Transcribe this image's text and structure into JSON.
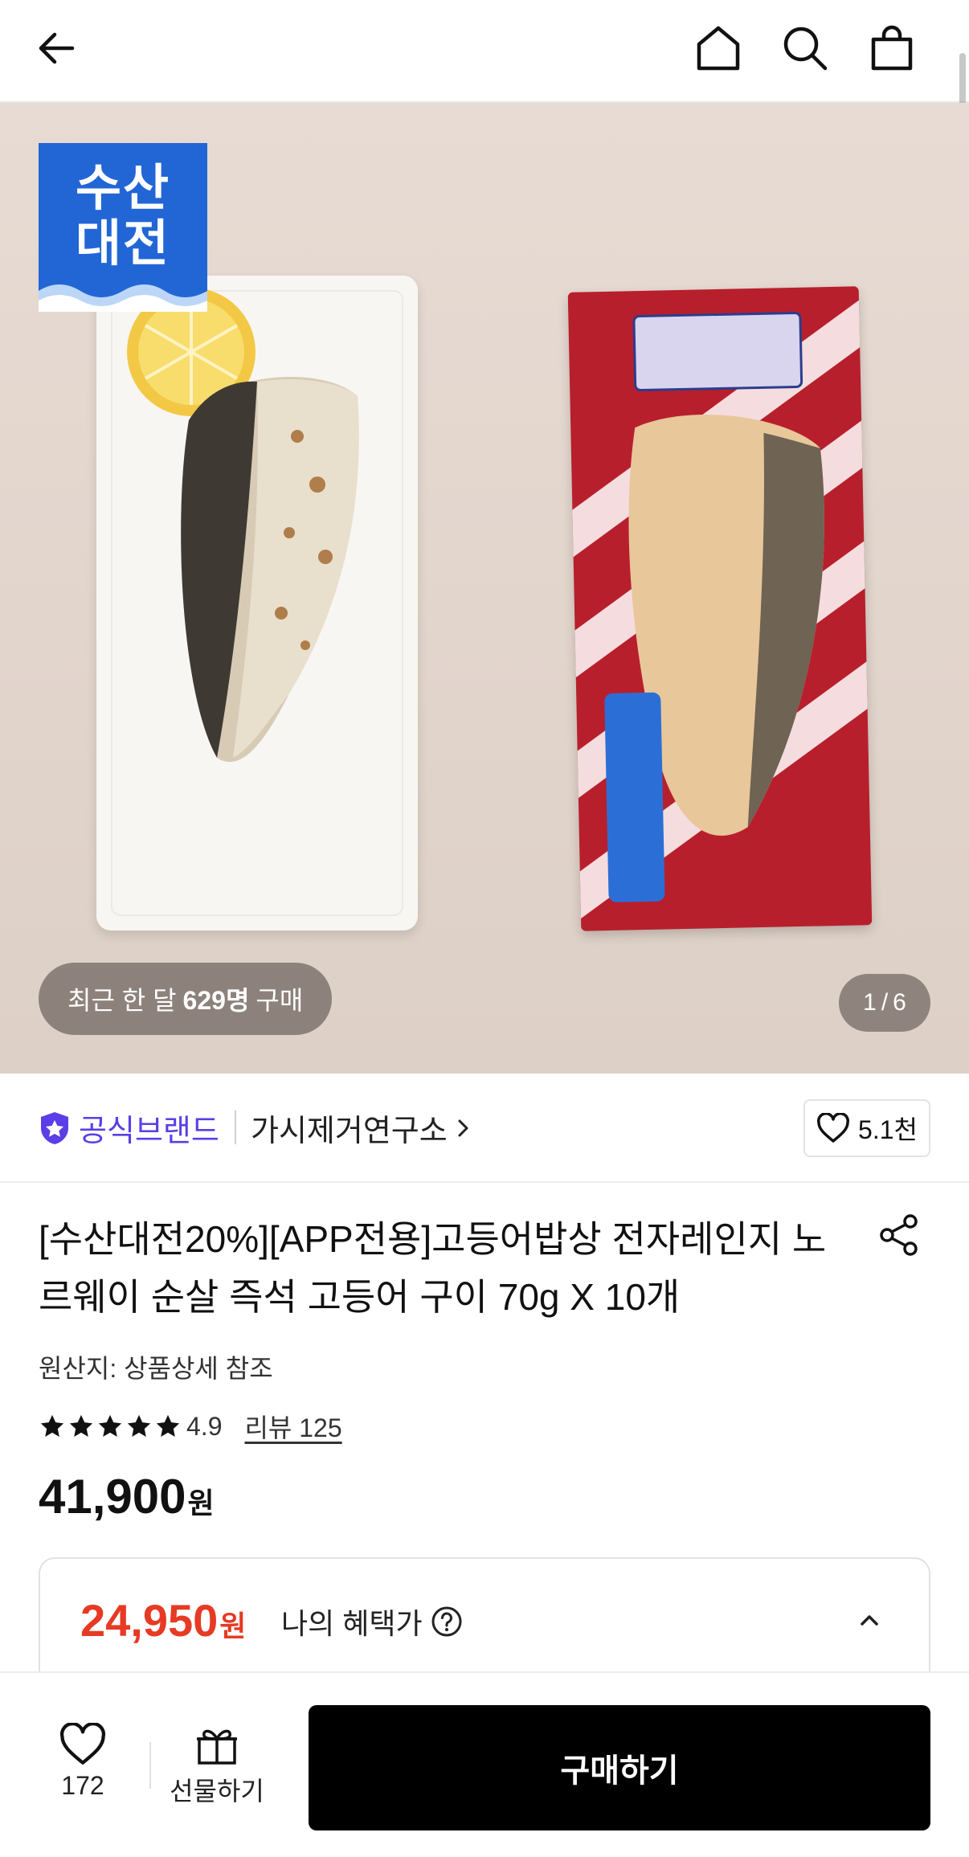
{
  "header": {
    "back_icon": "arrow-left-icon",
    "home_icon": "home-icon",
    "search_icon": "search-icon",
    "cart_icon": "shopping-bag-icon"
  },
  "hero": {
    "badge_line1": "수산",
    "badge_line2": "대전",
    "recent_prefix": "최근 한 달",
    "recent_count": "629명",
    "recent_suffix": "구매",
    "page_current": "1",
    "page_sep": "/",
    "page_total": "6"
  },
  "brand": {
    "official_label": "공식브랜드",
    "store_name": "가시제거연구소",
    "like_count": "5.1천",
    "accent_color": "#5b3ee8"
  },
  "product": {
    "title": "[수산대전20%][APP전용]고등어밥상 전자레인지 노르웨이 순살 즉석 고등어 구이 70g X 10개",
    "origin": "원산지: 상품상세 참조",
    "rating": "4.9",
    "stars": 5,
    "review_label": "리뷰 125",
    "price": "41,900",
    "price_unit": "원"
  },
  "benefit": {
    "price": "24,950",
    "price_unit": "원",
    "label": "나의 혜택가",
    "price_color": "#e63a24"
  },
  "bottom_bar": {
    "wish_count": "172",
    "gift_label": "선물하기",
    "buy_label": "구매하기"
  }
}
